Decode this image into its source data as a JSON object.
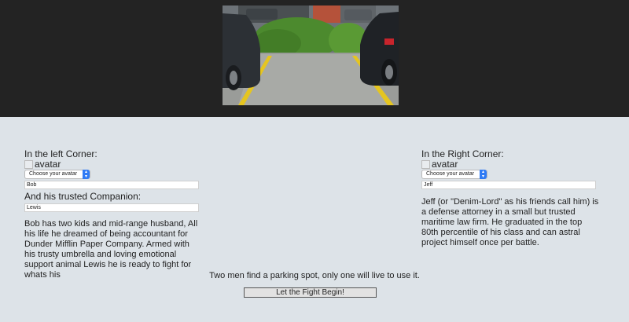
{
  "left_corner": {
    "heading": "In the left Corner:",
    "avatar_label": "avatar",
    "select_value": "Choose your avatar",
    "name_value": "Bob",
    "companion_label": "And his trusted Companion:",
    "companion_value": "Lewis",
    "bio": "Bob has two kids and mid-range husband, All his life he dreamed of being accountant for Dunder Mifflin Paper Company. Armed with his trusty umbrella and loving emotional support animal Lewis he is ready to fight for whats his"
  },
  "right_corner": {
    "heading": "In the Right Corner:",
    "avatar_label": "avatar",
    "select_value": "Choose your avatar",
    "name_value": "Jeff",
    "bio": "Jeff (or \"Denim-Lord\" as his friends call him) is a defense attorney in a small but trusted maritime law firm. He graduated in the top 80th percentile of his class and can astral project himself once per battle."
  },
  "tagline": "Two men find a parking spot, only one will live to use it.",
  "fight_button_label": "Let the Fight Begin!",
  "colors": {
    "page_bg": "#dde3e8",
    "top_band": "#232323",
    "select_accent": "#2f7bf5"
  },
  "icons": {
    "select_arrows": "up-down-chevron-icon",
    "avatar": "broken-image-icon"
  }
}
